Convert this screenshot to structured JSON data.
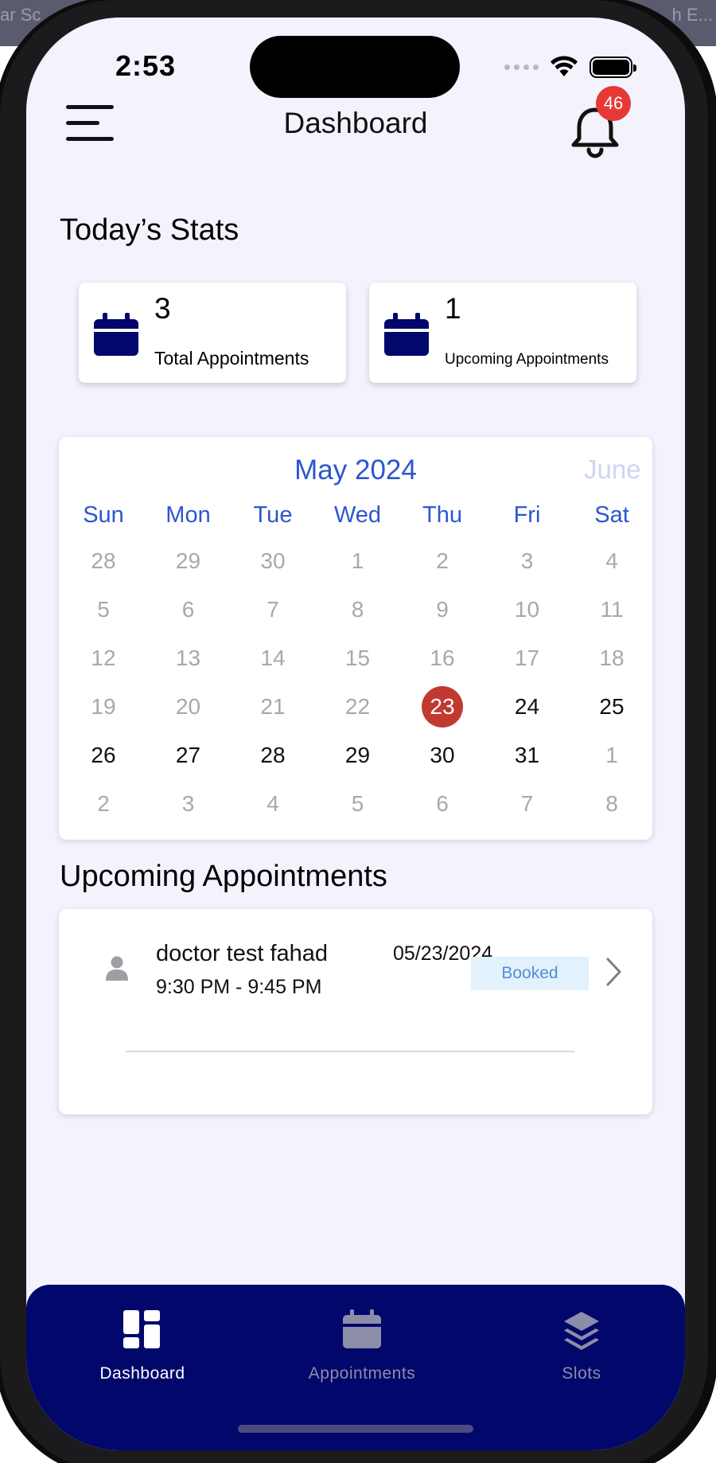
{
  "background": {
    "left_text": "ar Sc",
    "right_text": "h E..."
  },
  "status_bar": {
    "time": "2:53"
  },
  "header": {
    "title": "Dashboard",
    "notification_count": "46"
  },
  "stats": {
    "section_title": "Today’s Stats",
    "cards": [
      {
        "value": "3",
        "label": "Total Appointments"
      },
      {
        "value": "1",
        "label": "Upcoming Appointments"
      }
    ]
  },
  "calendar": {
    "month_title": "May 2024",
    "next_month_peek": "June",
    "weekdays": [
      "Sun",
      "Mon",
      "Tue",
      "Wed",
      "Thu",
      "Fri",
      "Sat"
    ],
    "weeks": [
      [
        "28",
        "29",
        "30",
        "1",
        "2",
        "3",
        "4"
      ],
      [
        "5",
        "6",
        "7",
        "8",
        "9",
        "10",
        "11"
      ],
      [
        "12",
        "13",
        "14",
        "15",
        "16",
        "17",
        "18"
      ],
      [
        "19",
        "20",
        "21",
        "22",
        "23",
        "24",
        "25"
      ],
      [
        "26",
        "27",
        "28",
        "29",
        "30",
        "31",
        "1"
      ],
      [
        "2",
        "3",
        "4",
        "5",
        "6",
        "7",
        "8"
      ]
    ],
    "selected_day": "23"
  },
  "upcoming": {
    "section_title": "Upcoming Appointments",
    "items": [
      {
        "name": "doctor test fahad",
        "time": "9:30 PM - 9:45 PM",
        "date": "05/23/2024",
        "status": "Booked"
      }
    ]
  },
  "tab_bar": {
    "tabs": [
      {
        "label": "Dashboard",
        "icon": "dashboard-icon",
        "active": true
      },
      {
        "label": "Appointments",
        "icon": "calendar-icon",
        "active": false
      },
      {
        "label": "Slots",
        "icon": "layers-icon",
        "active": false
      }
    ]
  },
  "colors": {
    "navy": "#02076b",
    "accent_blue": "#2c56d0",
    "today_red": "#c13a32",
    "badge_red": "#e53935",
    "screen_bg": "#f4f3fd"
  }
}
